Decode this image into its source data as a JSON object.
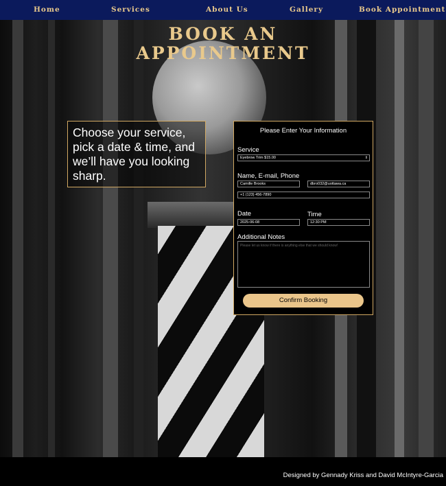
{
  "nav": {
    "items": [
      {
        "label": "Home"
      },
      {
        "label": "Services"
      },
      {
        "label": "About Us"
      },
      {
        "label": "Gallery"
      },
      {
        "label": "Book Appointment"
      }
    ],
    "bg_color": "#0b1a5c",
    "text_color": "#e9c98c"
  },
  "page_title": {
    "line1": "BOOK AN",
    "line2": "APPOINTMENT"
  },
  "intro": {
    "text": "Choose your service, pick a date & time, and we’ll have you looking sharp."
  },
  "form": {
    "title": "Please Enter Your Information",
    "service_label": "Service",
    "service_value": "Eyebrow Trim $15.00",
    "contact_label": "Name, E-mail, Phone",
    "name_value": "Camille Brooks",
    "email_value": "dbro032@uottawa.ca",
    "phone_value": "+1 (123) 456-7890",
    "date_label": "Date",
    "date_value": "2025-06-08",
    "time_label": "Time",
    "time_value": "12:30 PM",
    "notes_label": "Additional Notes",
    "notes_placeholder": "Please let us know if there is anything else that we should know!",
    "confirm_label": "Confirm Booking",
    "accent_color": "#eac58a"
  },
  "footer": {
    "credit": "Designed by Gennady Kriss and David McIntyre-Garcia"
  }
}
